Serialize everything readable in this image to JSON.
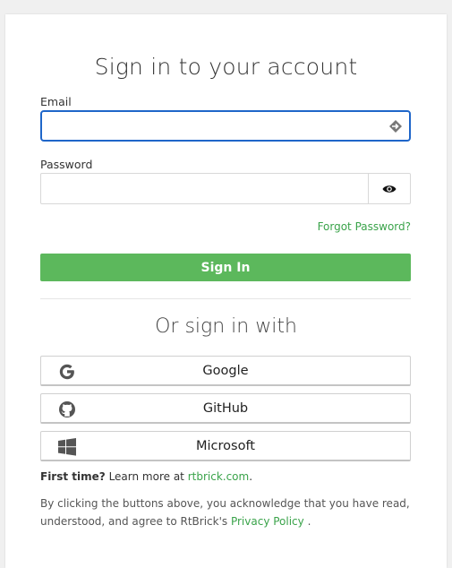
{
  "form": {
    "title": "Sign in to your account",
    "email_label": "Email",
    "email_value": "",
    "password_label": "Password",
    "password_value": "",
    "forgot_link": "Forgot Password?",
    "signin_button": "Sign In"
  },
  "social": {
    "heading": "Or sign in with",
    "providers": [
      {
        "label": "Google",
        "icon": "google-icon"
      },
      {
        "label": "GitHub",
        "icon": "github-icon"
      },
      {
        "label": "Microsoft",
        "icon": "windows-icon"
      }
    ]
  },
  "footer": {
    "first_time_bold": "First time?",
    "first_time_text": " Learn more at ",
    "first_time_link": "rtbrick.com",
    "first_time_end": ".",
    "legal_text": "By clicking the buttons above, you acknowledge that you have read, understood, and agree to RtBrick's ",
    "legal_link": "Privacy Policy",
    "legal_end": " ."
  },
  "colors": {
    "accent_green": "#5cb85c",
    "link_green": "#3aa34a",
    "focus_blue": "#1f66c9"
  }
}
